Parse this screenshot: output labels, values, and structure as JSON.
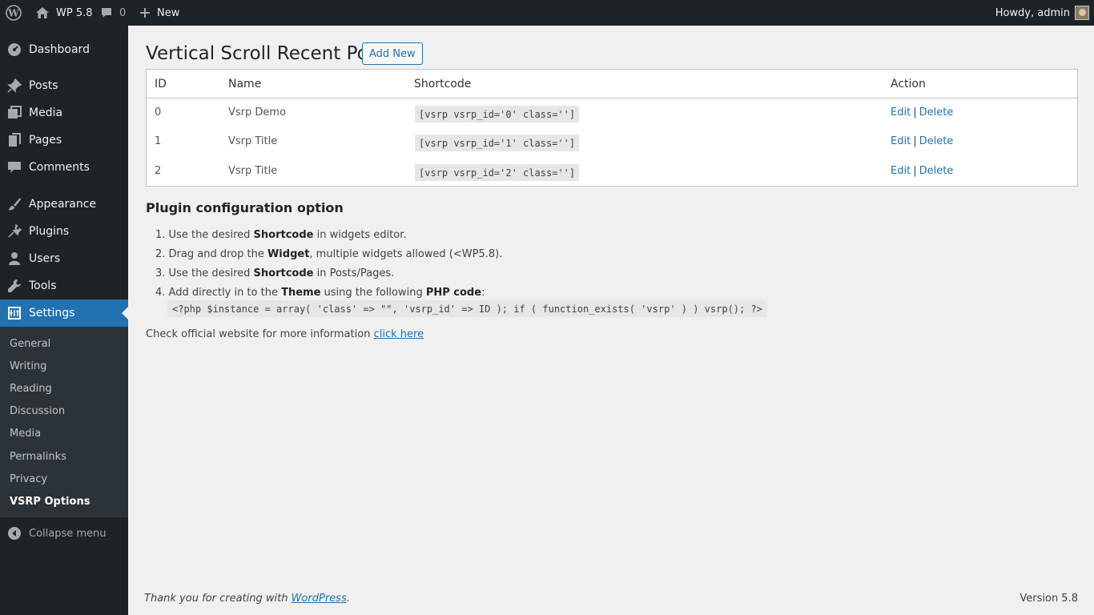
{
  "adminbar": {
    "site_name": "WP 5.8",
    "comments_count": "0",
    "new_label": "New",
    "howdy": "Howdy, admin"
  },
  "sidebar": {
    "items": [
      {
        "label": "Dashboard",
        "icon": "dashboard-icon"
      },
      {
        "label": "Posts",
        "icon": "pin-icon"
      },
      {
        "label": "Media",
        "icon": "media-icon"
      },
      {
        "label": "Pages",
        "icon": "page-icon"
      },
      {
        "label": "Comments",
        "icon": "comment-icon"
      },
      {
        "label": "Appearance",
        "icon": "brush-icon"
      },
      {
        "label": "Plugins",
        "icon": "plug-icon"
      },
      {
        "label": "Users",
        "icon": "user-icon"
      },
      {
        "label": "Tools",
        "icon": "wrench-icon"
      },
      {
        "label": "Settings",
        "icon": "settings-icon"
      }
    ],
    "submenu": [
      "General",
      "Writing",
      "Reading",
      "Discussion",
      "Media",
      "Permalinks",
      "Privacy",
      "VSRP Options"
    ],
    "collapse_label": "Collapse menu"
  },
  "page": {
    "title": "Vertical Scroll Recent Post",
    "add_new": "Add New"
  },
  "table": {
    "headers": [
      "ID",
      "Name",
      "Shortcode",
      "Action"
    ],
    "rows": [
      {
        "id": "0",
        "name": "Vsrp Demo",
        "shortcode": "[vsrp vsrp_id='0' class='']",
        "edit": "Edit",
        "sep": "|",
        "delete": "Delete"
      },
      {
        "id": "1",
        "name": "Vsrp Title",
        "shortcode": "[vsrp vsrp_id='1' class='']",
        "edit": "Edit",
        "sep": "|",
        "delete": "Delete"
      },
      {
        "id": "2",
        "name": "Vsrp Title",
        "shortcode": "[vsrp vsrp_id='2' class='']",
        "edit": "Edit",
        "sep": "|",
        "delete": "Delete"
      }
    ]
  },
  "config": {
    "title": "Plugin configuration option",
    "steps": [
      {
        "num": "1.",
        "pre": "Use the desired ",
        "bold": "Shortcode",
        "post": " in widgets editor."
      },
      {
        "num": "2.",
        "pre": "Drag and drop the ",
        "bold": "Widget",
        "post": ", multiple widgets allowed (<WP5.8)."
      },
      {
        "num": "3.",
        "pre": "Use the desired ",
        "bold": "Shortcode",
        "post": " in Posts/Pages."
      },
      {
        "num": "4.",
        "pre": "Add directly in to the ",
        "bold": "Theme",
        "mid": " using the following ",
        "bold2": "PHP code",
        "post": ":"
      }
    ],
    "php_code": "<?php $instance = array( 'class' => \"\", 'vsrp_id' => ID ); if ( function_exists( 'vsrp' ) ) vsrp(); ?>",
    "more_info_text": "Check official website for more information ",
    "more_info_link": "click here"
  },
  "footer": {
    "thanks_prefix": "Thank you for creating with ",
    "thanks_link": "WordPress",
    "thanks_suffix": ".",
    "version": "Version 5.8"
  }
}
